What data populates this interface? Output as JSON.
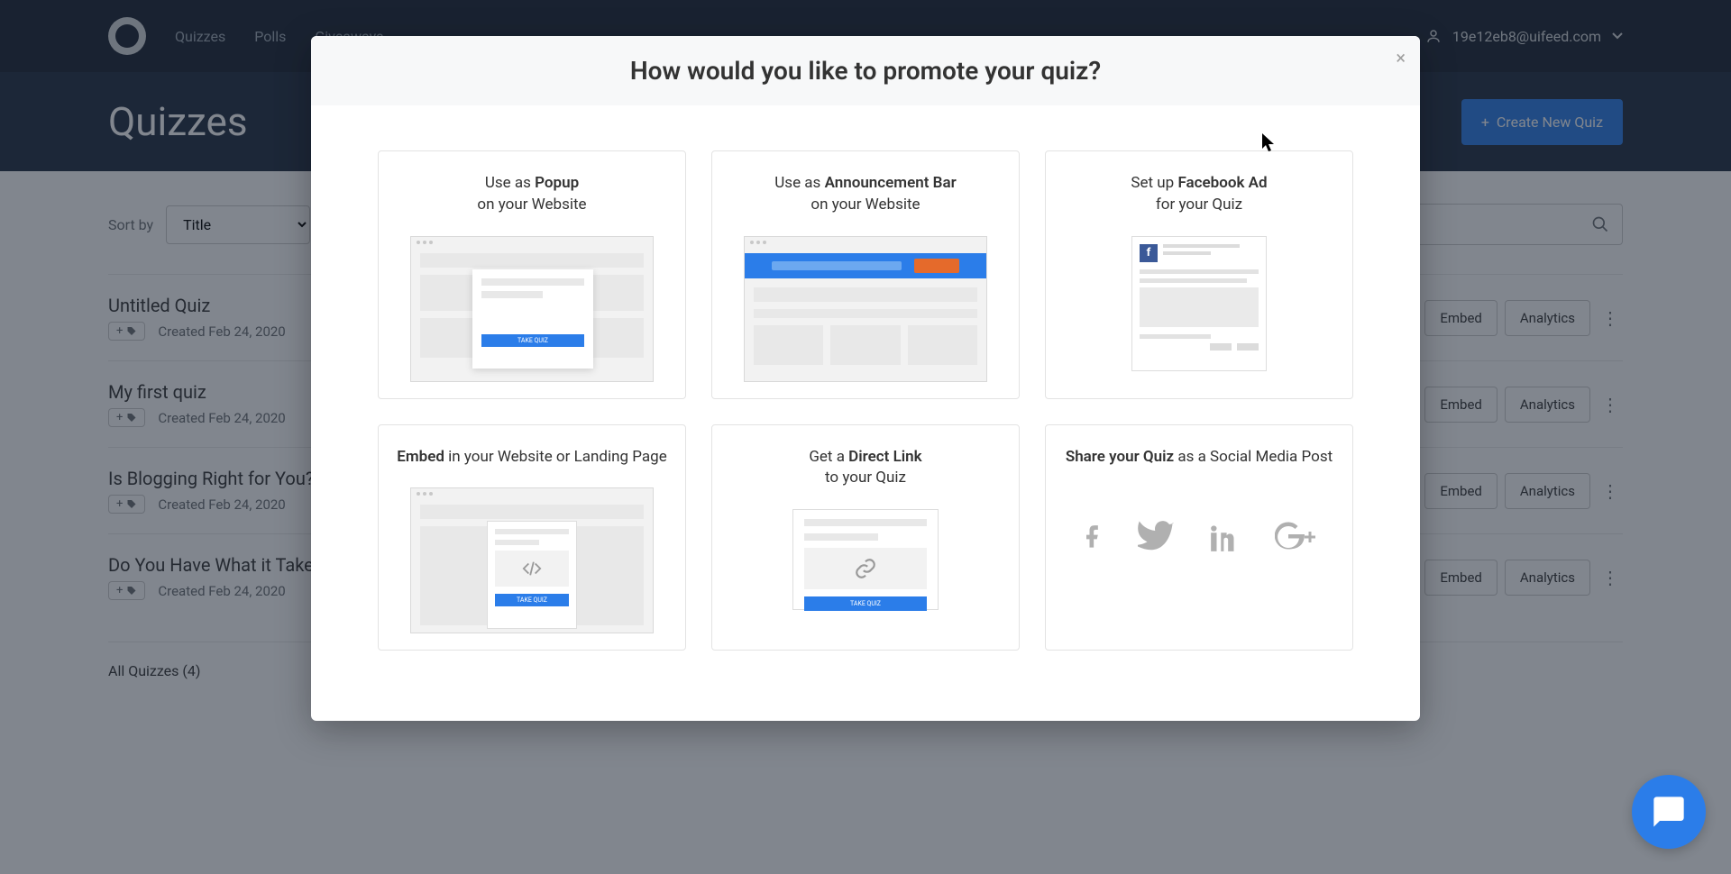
{
  "header": {
    "nav": [
      "Quizzes",
      "Polls",
      "Giveaways"
    ],
    "user_email": "19e12eb8@uifeed.com"
  },
  "page": {
    "title": "Quizzes",
    "create_btn": "Create New Quiz",
    "sort_label": "Sort by",
    "sort_value": "Title"
  },
  "quizzes": [
    {
      "title": "Untitled Quiz",
      "date": "Created Feb 24, 2020"
    },
    {
      "title": "My first quiz",
      "date": "Created Feb 24, 2020"
    },
    {
      "title": "Is Blogging Right for You?",
      "date": "Created Feb 24, 2020"
    },
    {
      "title": "Do You Have What it Takes?",
      "date": "Created Feb 24, 2020"
    }
  ],
  "all_quizzes_label": "All Quizzes (4)",
  "tag_btn": "+",
  "actions": {
    "embed": "Embed",
    "analytics": "Analytics"
  },
  "modal": {
    "title": "How would you like to promote your quiz?",
    "cards": {
      "popup_pre": "Use as ",
      "popup_bold": "Popup",
      "popup_post": "on your Website",
      "ann_pre": "Use as ",
      "ann_bold": "Announcement Bar",
      "ann_post": "on your Website",
      "fb_pre": "Set up ",
      "fb_bold": "Facebook Ad",
      "fb_post": "for your Quiz",
      "embed_bold": "Embed",
      "embed_post": " in your Website or Landing Page",
      "link_pre": "Get a ",
      "link_bold": "Direct Link",
      "link_post": "to your Quiz",
      "share_bold": "Share your Quiz",
      "share_post": " as a Social Media Post",
      "take_quiz": "TAKE QUIZ"
    }
  }
}
